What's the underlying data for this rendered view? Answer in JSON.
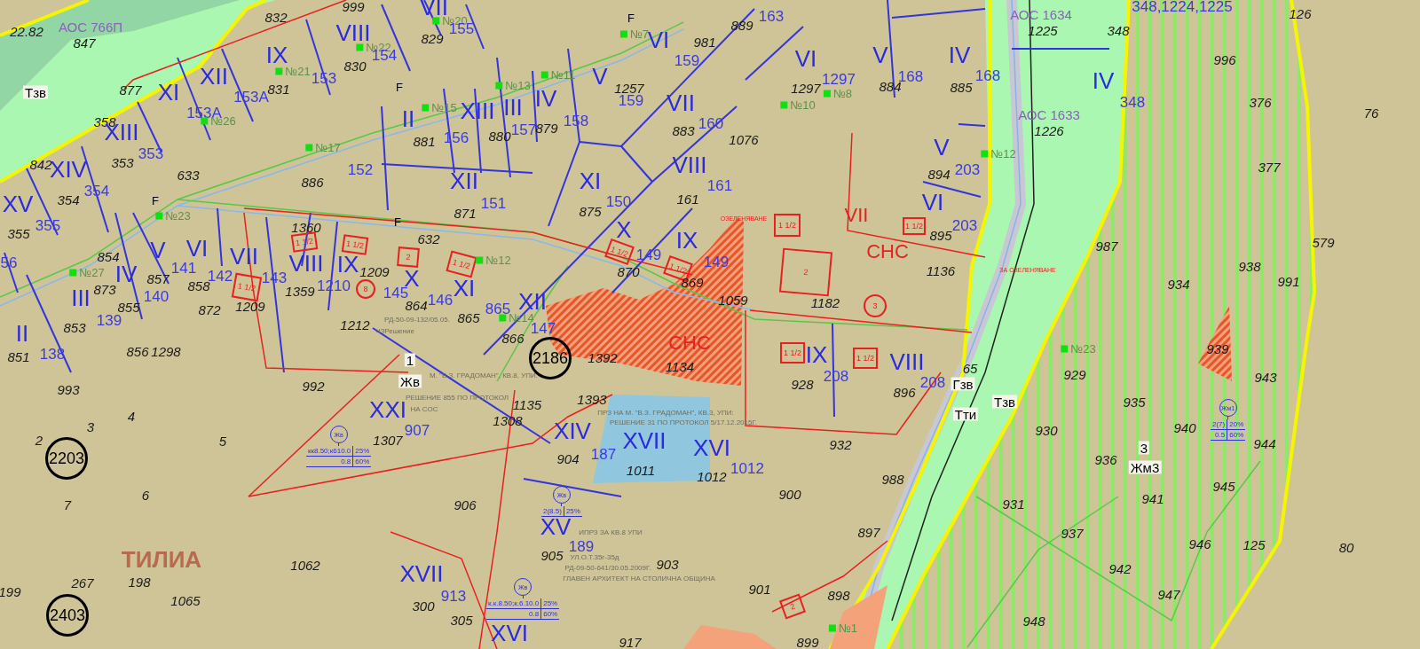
{
  "labels": [
    {
      "text": "832",
      "kind": "parcel"
    },
    {
      "text": "999",
      "kind": "parcel"
    },
    {
      "text": "VII",
      "kind": "roman"
    },
    {
      "text": "163",
      "kind": "lot"
    },
    {
      "text": "АОС 1634",
      "kind": "object"
    },
    {
      "text": "348,1224,1225",
      "kind": "lot"
    },
    {
      "text": "126",
      "kind": "parcel"
    },
    {
      "text": "22.82",
      "kind": "parcel"
    },
    {
      "text": "АОС 766П",
      "kind": "object"
    },
    {
      "text": "VIII",
      "kind": "roman"
    },
    {
      "text": "№20",
      "kind": "well"
    },
    {
      "text": "155",
      "kind": "lot"
    },
    {
      "text": "F",
      "kind": "mark"
    },
    {
      "text": "№7",
      "kind": "well"
    },
    {
      "text": "889",
      "kind": "parcel"
    },
    {
      "text": "1225",
      "kind": "parcel"
    },
    {
      "text": "348",
      "kind": "parcel"
    },
    {
      "text": "847",
      "kind": "parcel"
    },
    {
      "text": "№22",
      "kind": "well"
    },
    {
      "text": "829",
      "kind": "parcel"
    },
    {
      "text": "VI",
      "kind": "roman"
    },
    {
      "text": "981",
      "kind": "parcel"
    },
    {
      "text": "IX",
      "kind": "roman"
    },
    {
      "text": "830",
      "kind": "parcel"
    },
    {
      "text": "154",
      "kind": "lot"
    },
    {
      "text": "159",
      "kind": "lot"
    },
    {
      "text": "VI",
      "kind": "roman"
    },
    {
      "text": "V",
      "kind": "roman"
    },
    {
      "text": "IV",
      "kind": "roman"
    },
    {
      "text": "996",
      "kind": "parcel"
    },
    {
      "text": "XII",
      "kind": "roman"
    },
    {
      "text": "№21",
      "kind": "well"
    },
    {
      "text": "153",
      "kind": "lot"
    },
    {
      "text": "F",
      "kind": "mark"
    },
    {
      "text": "№13",
      "kind": "well"
    },
    {
      "text": "№11",
      "kind": "well"
    },
    {
      "text": "V",
      "kind": "roman"
    },
    {
      "text": "1257",
      "kind": "parcel"
    },
    {
      "text": "1297",
      "kind": "parcel"
    },
    {
      "text": "1297",
      "kind": "lot"
    },
    {
      "text": "884",
      "kind": "parcel"
    },
    {
      "text": "168",
      "kind": "lot"
    },
    {
      "text": "885",
      "kind": "parcel"
    },
    {
      "text": "168",
      "kind": "lot"
    },
    {
      "text": "IV",
      "kind": "roman"
    },
    {
      "text": "Тзв",
      "kind": "zone"
    },
    {
      "text": "877",
      "kind": "parcel"
    },
    {
      "text": "XI",
      "kind": "roman"
    },
    {
      "text": "153А",
      "kind": "lot"
    },
    {
      "text": "831",
      "kind": "parcel"
    },
    {
      "text": "IV",
      "kind": "roman"
    },
    {
      "text": "159",
      "kind": "lot"
    },
    {
      "text": "VII",
      "kind": "roman"
    },
    {
      "text": "№10",
      "kind": "well"
    },
    {
      "text": "№8",
      "kind": "well"
    },
    {
      "text": "348",
      "kind": "lot"
    },
    {
      "text": "376",
      "kind": "parcel"
    },
    {
      "text": "358",
      "kind": "parcel"
    },
    {
      "text": "153А",
      "kind": "lot"
    },
    {
      "text": "№26",
      "kind": "well"
    },
    {
      "text": "II",
      "kind": "roman"
    },
    {
      "text": "№15",
      "kind": "well"
    },
    {
      "text": "XIII",
      "kind": "roman"
    },
    {
      "text": "III",
      "kind": "roman"
    },
    {
      "text": "158",
      "kind": "lot"
    },
    {
      "text": "160",
      "kind": "lot"
    },
    {
      "text": "АОС 1633",
      "kind": "object"
    },
    {
      "text": "76",
      "kind": "parcel"
    },
    {
      "text": "XIII",
      "kind": "roman"
    },
    {
      "text": "881",
      "kind": "parcel"
    },
    {
      "text": "156",
      "kind": "lot"
    },
    {
      "text": "880",
      "kind": "parcel"
    },
    {
      "text": "157",
      "kind": "lot"
    },
    {
      "text": "879",
      "kind": "parcel"
    },
    {
      "text": "883",
      "kind": "parcel"
    },
    {
      "text": "1076",
      "kind": "parcel"
    },
    {
      "text": "1226",
      "kind": "parcel"
    },
    {
      "text": "353",
      "kind": "lot"
    },
    {
      "text": "№17",
      "kind": "well"
    },
    {
      "text": "V",
      "kind": "roman"
    },
    {
      "text": "№12",
      "kind": "well"
    },
    {
      "text": "842",
      "kind": "parcel"
    },
    {
      "text": "XIV",
      "kind": "roman"
    },
    {
      "text": "353",
      "kind": "parcel"
    },
    {
      "text": "633",
      "kind": "parcel"
    },
    {
      "text": "152",
      "kind": "lot"
    },
    {
      "text": "VIII",
      "kind": "roman"
    },
    {
      "text": "894",
      "kind": "parcel"
    },
    {
      "text": "203",
      "kind": "lot"
    },
    {
      "text": "377",
      "kind": "parcel"
    },
    {
      "text": "354",
      "kind": "lot"
    },
    {
      "text": "886",
      "kind": "parcel"
    },
    {
      "text": "XII",
      "kind": "roman"
    },
    {
      "text": "XI",
      "kind": "roman"
    },
    {
      "text": "161",
      "kind": "lot"
    },
    {
      "text": "XV",
      "kind": "roman"
    },
    {
      "text": "354",
      "kind": "parcel"
    },
    {
      "text": "F",
      "kind": "mark"
    },
    {
      "text": "151",
      "kind": "lot"
    },
    {
      "text": "875",
      "kind": "parcel"
    },
    {
      "text": "150",
      "kind": "lot"
    },
    {
      "text": "161",
      "kind": "parcel"
    },
    {
      "text": "VI",
      "kind": "roman"
    },
    {
      "text": "355",
      "kind": "lot"
    },
    {
      "text": "№23",
      "kind": "well"
    },
    {
      "text": "1360",
      "kind": "parcel"
    },
    {
      "text": "F",
      "kind": "mark"
    },
    {
      "text": "871",
      "kind": "parcel"
    },
    {
      "text": "X",
      "kind": "roman"
    },
    {
      "text": "ОЗЕЛЕНЯВАНЕ",
      "kind": "plan_small"
    },
    {
      "text": "VII",
      "kind": "plan"
    },
    {
      "text": "203",
      "kind": "lot"
    },
    {
      "text": "355",
      "kind": "parcel"
    },
    {
      "text": "632",
      "kind": "parcel"
    },
    {
      "text": "IX",
      "kind": "roman"
    },
    {
      "text": "СНС",
      "kind": "plan"
    },
    {
      "text": "895",
      "kind": "parcel"
    },
    {
      "text": "987",
      "kind": "parcel"
    },
    {
      "text": "579",
      "kind": "parcel"
    },
    {
      "text": "56",
      "kind": "lot"
    },
    {
      "text": "854",
      "kind": "parcel"
    },
    {
      "text": "V",
      "kind": "roman"
    },
    {
      "text": "VI",
      "kind": "roman"
    },
    {
      "text": "VII",
      "kind": "roman"
    },
    {
      "text": "VIII",
      "kind": "roman"
    },
    {
      "text": "IX",
      "kind": "roman"
    },
    {
      "text": "№12",
      "kind": "well"
    },
    {
      "text": "149",
      "kind": "lot"
    },
    {
      "text": "149",
      "kind": "lot"
    },
    {
      "text": "№27",
      "kind": "well"
    },
    {
      "text": "IV",
      "kind": "roman"
    },
    {
      "text": "857",
      "kind": "parcel"
    },
    {
      "text": "141",
      "kind": "lot"
    },
    {
      "text": "142",
      "kind": "lot"
    },
    {
      "text": "143",
      "kind": "lot"
    },
    {
      "text": "1210",
      "kind": "lot"
    },
    {
      "text": "1209",
      "kind": "parcel"
    },
    {
      "text": "X",
      "kind": "roman"
    },
    {
      "text": "870",
      "kind": "parcel"
    },
    {
      "text": "869",
      "kind": "parcel"
    },
    {
      "text": "1136",
      "kind": "parcel"
    },
    {
      "text": "ЗА ОЗЕЛЕНЯВАНЕ",
      "kind": "plan_small"
    },
    {
      "text": "938",
      "kind": "parcel"
    },
    {
      "text": "991",
      "kind": "parcel"
    },
    {
      "text": "III",
      "kind": "roman"
    },
    {
      "text": "873",
      "kind": "parcel"
    },
    {
      "text": "140",
      "kind": "lot"
    },
    {
      "text": "858",
      "kind": "parcel"
    },
    {
      "text": "1209",
      "kind": "parcel"
    },
    {
      "text": "1359",
      "kind": "parcel"
    },
    {
      "text": "145",
      "kind": "lot"
    },
    {
      "text": "146",
      "kind": "lot"
    },
    {
      "text": "XI",
      "kind": "roman"
    },
    {
      "text": "1059",
      "kind": "parcel"
    },
    {
      "text": "934",
      "kind": "parcel"
    },
    {
      "text": "855",
      "kind": "parcel"
    },
    {
      "text": "872",
      "kind": "parcel"
    },
    {
      "text": "864",
      "kind": "parcel"
    },
    {
      "text": "865",
      "kind": "parcel"
    },
    {
      "text": "865",
      "kind": "lot"
    },
    {
      "text": "№14",
      "kind": "well"
    },
    {
      "text": "XII",
      "kind": "roman"
    },
    {
      "text": "1182",
      "kind": "parcel"
    },
    {
      "text": "II",
      "kind": "roman"
    },
    {
      "text": "853",
      "kind": "parcel"
    },
    {
      "text": "139",
      "kind": "lot"
    },
    {
      "text": "1212",
      "kind": "parcel"
    },
    {
      "text": "РД-50-09-132/05.05.",
      "kind": "note"
    },
    {
      "text": "ЧЗРешение",
      "kind": "note"
    },
    {
      "text": "147",
      "kind": "lot"
    },
    {
      "text": "138",
      "kind": "lot"
    },
    {
      "text": "856",
      "kind": "parcel"
    },
    {
      "text": "1298",
      "kind": "parcel"
    },
    {
      "text": "866",
      "kind": "parcel"
    },
    {
      "text": "СНС",
      "kind": "plan"
    },
    {
      "text": "№23",
      "kind": "well"
    },
    {
      "text": "939",
      "kind": "parcel"
    },
    {
      "text": "851",
      "kind": "parcel"
    },
    {
      "text": "1",
      "kind": "zone"
    },
    {
      "text": "2186",
      "kind": "circled"
    },
    {
      "text": "1392",
      "kind": "parcel"
    },
    {
      "text": "1134",
      "kind": "parcel"
    },
    {
      "text": "IX",
      "kind": "roman"
    },
    {
      "text": "VIII",
      "kind": "roman"
    },
    {
      "text": "65",
      "kind": "parcel"
    },
    {
      "text": "993",
      "kind": "parcel"
    },
    {
      "text": "992",
      "kind": "parcel"
    },
    {
      "text": "Жв",
      "kind": "zone"
    },
    {
      "text": "М. \"В.З. ГРАДОМАН\", КВ.8, УПИ:",
      "kind": "note"
    },
    {
      "text": "928",
      "kind": "parcel"
    },
    {
      "text": "208",
      "kind": "lot"
    },
    {
      "text": "208",
      "kind": "lot"
    },
    {
      "text": "Гзв",
      "kind": "zone"
    },
    {
      "text": "929",
      "kind": "parcel"
    },
    {
      "text": "943",
      "kind": "parcel"
    },
    {
      "text": "РЕШЕНИЕ 855 ПО ПРОТОКОЛ",
      "kind": "note"
    },
    {
      "text": "1135",
      "kind": "parcel"
    },
    {
      "text": "1393",
      "kind": "parcel"
    },
    {
      "text": "896",
      "kind": "parcel"
    },
    {
      "text": "Тзв",
      "kind": "zone"
    },
    {
      "text": "935",
      "kind": "parcel"
    },
    {
      "text": "4",
      "kind": "parcel"
    },
    {
      "text": "XXI",
      "kind": "roman"
    },
    {
      "text": "НА СОС",
      "kind": "note"
    },
    {
      "text": "1308",
      "kind": "parcel"
    },
    {
      "text": "ПРЗ НА М. \"В.З. ГРАДОМАН\", КВ.3, УПИ:",
      "kind": "note"
    },
    {
      "text": "РЕШЕНИЕ 31 ПО ПРОТОКОЛ 5/17.12.2015Г.",
      "kind": "note"
    },
    {
      "text": "Тти",
      "kind": "zone"
    },
    {
      "text": "2",
      "kind": "parcel"
    },
    {
      "text": "3",
      "kind": "parcel"
    },
    {
      "text": "5",
      "kind": "parcel"
    },
    {
      "text": "1307",
      "kind": "parcel"
    },
    {
      "text": "907",
      "kind": "lot"
    },
    {
      "text": "XIV",
      "kind": "roman"
    },
    {
      "text": "XVII",
      "kind": "roman"
    },
    {
      "text": "930",
      "kind": "parcel"
    },
    {
      "text": "940",
      "kind": "parcel"
    },
    {
      "text": "2203",
      "kind": "circled"
    },
    {
      "text": "904",
      "kind": "parcel"
    },
    {
      "text": "187",
      "kind": "lot"
    },
    {
      "text": "XVI",
      "kind": "roman"
    },
    {
      "text": "932",
      "kind": "parcel"
    },
    {
      "text": "936",
      "kind": "parcel"
    },
    {
      "text": "3",
      "kind": "zone"
    },
    {
      "text": "944",
      "kind": "parcel"
    },
    {
      "text": "1011",
      "kind": "parcel"
    },
    {
      "text": "1012",
      "kind": "parcel"
    },
    {
      "text": "1012",
      "kind": "lot"
    },
    {
      "text": "Жм3",
      "kind": "zone"
    },
    {
      "text": "6",
      "kind": "parcel"
    },
    {
      "text": "900",
      "kind": "parcel"
    },
    {
      "text": "988",
      "kind": "parcel"
    },
    {
      "text": "945",
      "kind": "parcel"
    },
    {
      "text": "7",
      "kind": "parcel"
    },
    {
      "text": "906",
      "kind": "parcel"
    },
    {
      "text": "931",
      "kind": "parcel"
    },
    {
      "text": "941",
      "kind": "parcel"
    },
    {
      "text": "XV",
      "kind": "roman"
    },
    {
      "text": "ИПРЗ ЗА КВ.8 УПИ",
      "kind": "note"
    },
    {
      "text": "189",
      "kind": "lot"
    },
    {
      "text": "897",
      "kind": "parcel"
    },
    {
      "text": "937",
      "kind": "parcel"
    },
    {
      "text": "946",
      "kind": "parcel"
    },
    {
      "text": "125",
      "kind": "parcel"
    },
    {
      "text": "80",
      "kind": "parcel"
    },
    {
      "text": "ТИЛИА",
      "kind": "place"
    },
    {
      "text": "1062",
      "kind": "parcel"
    },
    {
      "text": "905",
      "kind": "parcel"
    },
    {
      "text": "УЛ.О.Т.35г-35д",
      "kind": "note"
    },
    {
      "text": "903",
      "kind": "parcel"
    },
    {
      "text": "267",
      "kind": "parcel"
    },
    {
      "text": "198",
      "kind": "parcel"
    },
    {
      "text": "XVII",
      "kind": "roman"
    },
    {
      "text": "РД-09-50-641/30.05.2009Г.",
      "kind": "note"
    },
    {
      "text": "ГЛАВЕН АРХИТЕКТ НА СТОЛИЧНА ОБЩИНА",
      "kind": "note"
    },
    {
      "text": "942",
      "kind": "parcel"
    },
    {
      "text": "199",
      "kind": "parcel"
    },
    {
      "text": "1065",
      "kind": "parcel"
    },
    {
      "text": "913",
      "kind": "lot"
    },
    {
      "text": "901",
      "kind": "parcel"
    },
    {
      "text": "898",
      "kind": "parcel"
    },
    {
      "text": "947",
      "kind": "parcel"
    },
    {
      "text": "2403",
      "kind": "circled"
    },
    {
      "text": "300",
      "kind": "parcel"
    },
    {
      "text": "305",
      "kind": "parcel"
    },
    {
      "text": "XVI",
      "kind": "roman"
    },
    {
      "text": "№1",
      "kind": "well"
    },
    {
      "text": "948",
      "kind": "parcel"
    },
    {
      "text": "917",
      "kind": "parcel"
    },
    {
      "text": "899",
      "kind": "parcel"
    }
  ],
  "buildings": [
    {
      "text": "1 1/2",
      "kind": "square"
    },
    {
      "text": "1 1/2",
      "kind": "square"
    },
    {
      "text": "2",
      "kind": "square"
    },
    {
      "text": "1 1/2",
      "kind": "square"
    },
    {
      "text": "1 1/2",
      "kind": "square"
    },
    {
      "text": "1 1/2",
      "kind": "square"
    },
    {
      "text": "1 1/2",
      "kind": "square"
    },
    {
      "text": "1 1/2",
      "kind": "square"
    },
    {
      "text": "2",
      "kind": "square"
    },
    {
      "text": "1 1/2",
      "kind": "square"
    },
    {
      "text": "1 1/2",
      "kind": "square"
    },
    {
      "text": "1 1/2",
      "kind": "square"
    },
    {
      "text": "2",
      "kind": "square"
    },
    {
      "text": "3",
      "kind": "circle"
    },
    {
      "text": "8",
      "kind": "circle"
    }
  ],
  "norm_tables": [
    {
      "zone": "Жв",
      "rows": [
        [
          "кк8.50;к610.0",
          "25%"
        ],
        [
          "0.8",
          "60%"
        ]
      ]
    },
    {
      "zone": "Жв",
      "rows": [
        [
          "2(8.5)",
          "25%"
        ]
      ]
    },
    {
      "zone": "Жв",
      "rows": [
        [
          "к.к.8.50;к.6.10.0",
          "25%"
        ],
        [
          "0.8",
          "60%"
        ]
      ]
    },
    {
      "zone": "Жм1",
      "rows": [
        [
          "2(7)",
          "20%"
        ],
        [
          "0.5",
          "60%"
        ]
      ]
    }
  ]
}
